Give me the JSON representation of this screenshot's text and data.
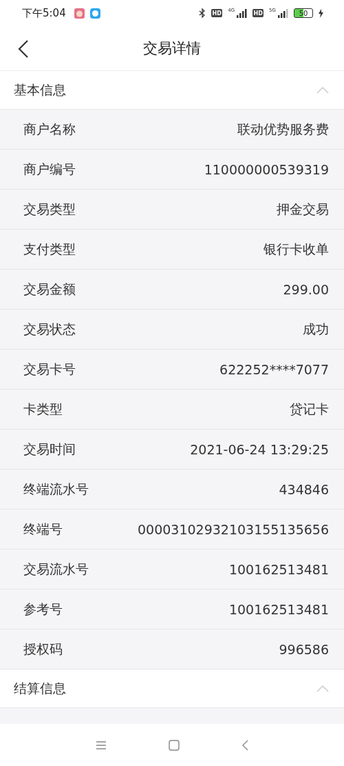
{
  "status_bar": {
    "time": "下午5:04",
    "hd_1": "HD",
    "network_1": "4G",
    "hd_2": "HD",
    "network_2": "5G",
    "battery": "50"
  },
  "header": {
    "title": "交易详情"
  },
  "sections": [
    {
      "title": "基本信息",
      "expanded": true,
      "rows": [
        {
          "label": "商户名称",
          "value": "联动优势服务费"
        },
        {
          "label": "商户编号",
          "value": "110000000539319"
        },
        {
          "label": "交易类型",
          "value": "押金交易"
        },
        {
          "label": "支付类型",
          "value": "银行卡收单"
        },
        {
          "label": "交易金额",
          "value": "299.00"
        },
        {
          "label": "交易状态",
          "value": "成功"
        },
        {
          "label": "交易卡号",
          "value": "622252****7077"
        },
        {
          "label": "卡类型",
          "value": "贷记卡"
        },
        {
          "label": "交易时间",
          "value": "2021-06-24 13:29:25"
        },
        {
          "label": "终端流水号",
          "value": "434846"
        },
        {
          "label": "终端号",
          "value": "00003102932103155135656"
        },
        {
          "label": "交易流水号",
          "value": "100162513481"
        },
        {
          "label": "参考号",
          "value": "100162513481"
        },
        {
          "label": "授权码",
          "value": "996586"
        }
      ]
    },
    {
      "title": "结算信息",
      "expanded": true
    }
  ]
}
